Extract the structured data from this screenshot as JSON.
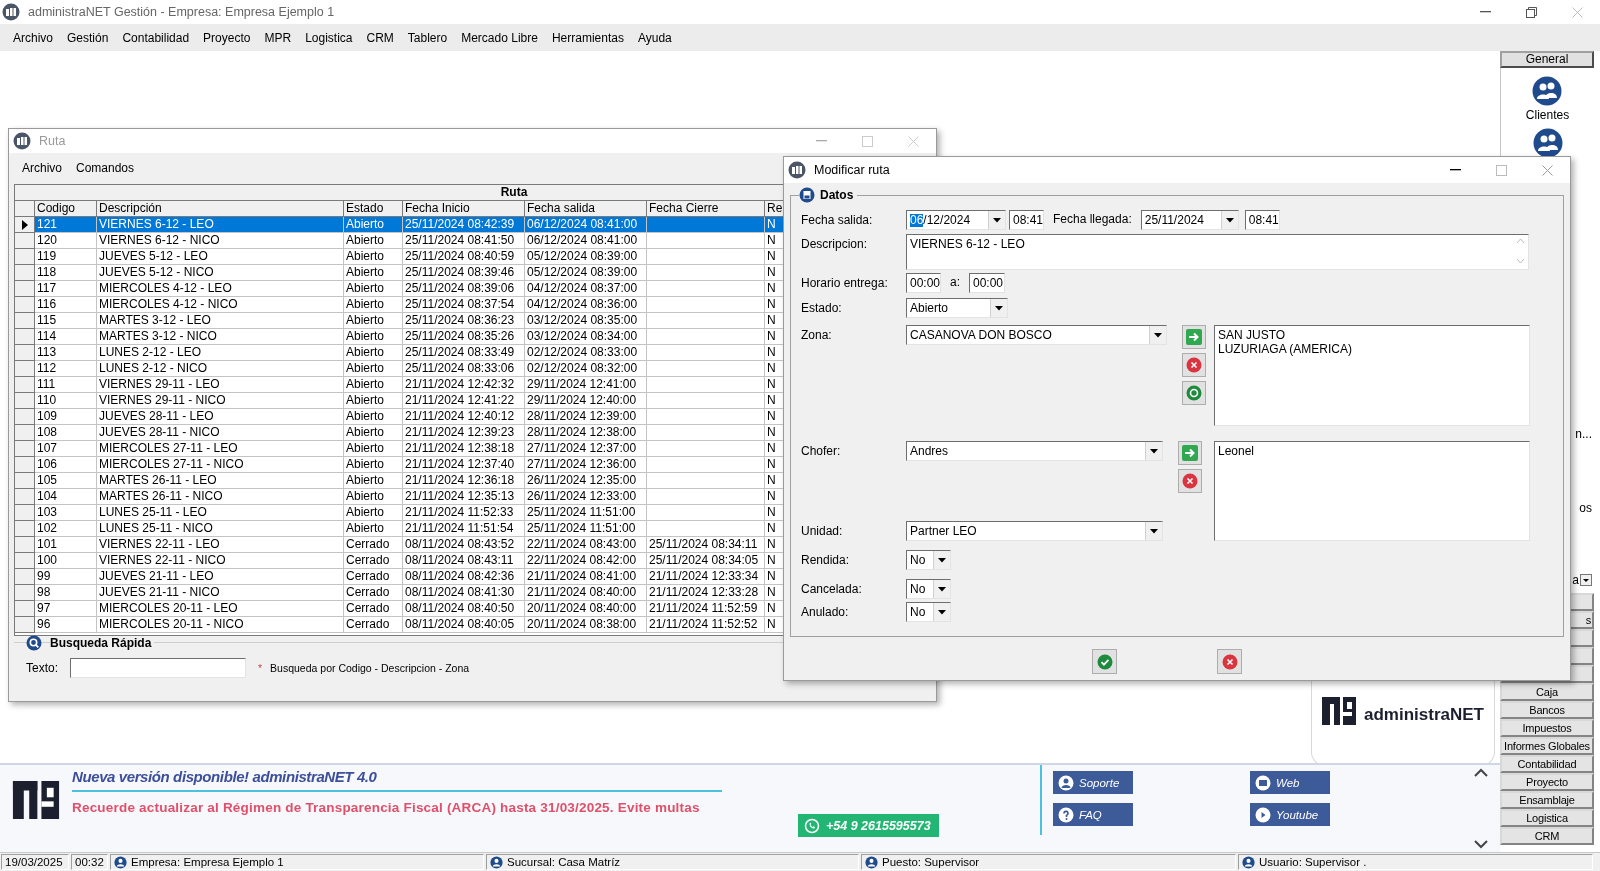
{
  "app": {
    "title": "administraNET Gestión - Empresa: Empresa Ejemplo 1",
    "menu": [
      {
        "label": "Archivo"
      },
      {
        "label": "Gestión"
      },
      {
        "label": "Contabilidad"
      },
      {
        "label": "Proyecto"
      },
      {
        "label": "MPR"
      },
      {
        "label": "Logistica"
      },
      {
        "label": "CRM"
      },
      {
        "label": "Tablero"
      },
      {
        "label": "Mercado Libre"
      },
      {
        "label": "Herramientas"
      },
      {
        "label": "Ayuda"
      }
    ]
  },
  "ruta_window": {
    "title": "Ruta",
    "menu": [
      {
        "label": "Archivo"
      },
      {
        "label": "Comandos"
      }
    ],
    "grid": {
      "title": "Ruta",
      "columns": [
        "Codigo",
        "Descripción",
        "Estado",
        "Fecha Inicio",
        "Fecha salida",
        "Fecha Cierre",
        "Re"
      ],
      "rows": [
        {
          "selected": true,
          "cells": [
            "121",
            "VIERNES 6-12 - LEO",
            "Abierto",
            "25/11/2024 08:42:39",
            "06/12/2024 08:41:00",
            "",
            "N"
          ]
        },
        {
          "selected": false,
          "cells": [
            "120",
            "VIERNES 6-12 - NICO",
            "Abierto",
            "25/11/2024 08:41:50",
            "06/12/2024 08:41:00",
            "",
            "N"
          ]
        },
        {
          "selected": false,
          "cells": [
            "119",
            "JUEVES 5-12 - LEO",
            "Abierto",
            "25/11/2024 08:40:59",
            "05/12/2024 08:39:00",
            "",
            "N"
          ]
        },
        {
          "selected": false,
          "cells": [
            "118",
            "JUEVES 5-12 - NICO",
            "Abierto",
            "25/11/2024 08:39:46",
            "05/12/2024 08:39:00",
            "",
            "N"
          ]
        },
        {
          "selected": false,
          "cells": [
            "117",
            "MIERCOLES 4-12 - LEO",
            "Abierto",
            "25/11/2024 08:39:06",
            "04/12/2024 08:37:00",
            "",
            "N"
          ]
        },
        {
          "selected": false,
          "cells": [
            "116",
            "MIERCOLES 4-12 - NICO",
            "Abierto",
            "25/11/2024 08:37:54",
            "04/12/2024 08:36:00",
            "",
            "N"
          ]
        },
        {
          "selected": false,
          "cells": [
            "115",
            "MARTES 3-12 - LEO",
            "Abierto",
            "25/11/2024 08:36:23",
            "03/12/2024 08:35:00",
            "",
            "N"
          ]
        },
        {
          "selected": false,
          "cells": [
            "114",
            "MARTES 3-12 - NICO",
            "Abierto",
            "25/11/2024 08:35:26",
            "03/12/2024 08:34:00",
            "",
            "N"
          ]
        },
        {
          "selected": false,
          "cells": [
            "113",
            "LUNES 2-12 - LEO",
            "Abierto",
            "25/11/2024 08:33:49",
            "02/12/2024 08:33:00",
            "",
            "N"
          ]
        },
        {
          "selected": false,
          "cells": [
            "112",
            "LUNES 2-12 - NICO",
            "Abierto",
            "25/11/2024 08:33:06",
            "02/12/2024 08:32:00",
            "",
            "N"
          ]
        },
        {
          "selected": false,
          "cells": [
            "111",
            "VIERNES 29-11 - LEO",
            "Abierto",
            "21/11/2024 12:42:32",
            "29/11/2024 12:41:00",
            "",
            "N"
          ]
        },
        {
          "selected": false,
          "cells": [
            "110",
            "VIERNES 29-11 - NICO",
            "Abierto",
            "21/11/2024 12:41:22",
            "29/11/2024 12:40:00",
            "",
            "N"
          ]
        },
        {
          "selected": false,
          "cells": [
            "109",
            "JUEVES 28-11 - LEO",
            "Abierto",
            "21/11/2024 12:40:12",
            "28/11/2024 12:39:00",
            "",
            "N"
          ]
        },
        {
          "selected": false,
          "cells": [
            "108",
            "JUEVES 28-11 - NICO",
            "Abierto",
            "21/11/2024 12:39:23",
            "28/11/2024 12:38:00",
            "",
            "N"
          ]
        },
        {
          "selected": false,
          "cells": [
            "107",
            "MIERCOLES 27-11 - LEO",
            "Abierto",
            "21/11/2024 12:38:18",
            "27/11/2024 12:37:00",
            "",
            "N"
          ]
        },
        {
          "selected": false,
          "cells": [
            "106",
            "MIERCOLES 27-11 - NICO",
            "Abierto",
            "21/11/2024 12:37:40",
            "27/11/2024 12:36:00",
            "",
            "N"
          ]
        },
        {
          "selected": false,
          "cells": [
            "105",
            "MARTES 26-11 - LEO",
            "Abierto",
            "21/11/2024 12:36:18",
            "26/11/2024 12:35:00",
            "",
            "N"
          ]
        },
        {
          "selected": false,
          "cells": [
            "104",
            "MARTES 26-11 - NICO",
            "Abierto",
            "21/11/2024 12:35:13",
            "26/11/2024 12:33:00",
            "",
            "N"
          ]
        },
        {
          "selected": false,
          "cells": [
            "103",
            "LUNES 25-11 - LEO",
            "Abierto",
            "21/11/2024 11:52:33",
            "25/11/2024 11:51:00",
            "",
            "N"
          ]
        },
        {
          "selected": false,
          "cells": [
            "102",
            "LUNES 25-11 - NICO",
            "Abierto",
            "21/11/2024 11:51:54",
            "25/11/2024 11:51:00",
            "",
            "N"
          ]
        },
        {
          "selected": false,
          "cells": [
            "101",
            "VIERNES 22-11 - LEO",
            "Cerrado",
            "08/11/2024 08:43:52",
            "22/11/2024 08:43:00",
            "25/11/2024 08:34:11",
            "N"
          ]
        },
        {
          "selected": false,
          "cells": [
            "100",
            "VIERNES 22-11 - NICO",
            "Cerrado",
            "08/11/2024 08:43:11",
            "22/11/2024 08:42:00",
            "25/11/2024 08:34:05",
            "N"
          ]
        },
        {
          "selected": false,
          "cells": [
            "99",
            "JUEVES 21-11 - LEO",
            "Cerrado",
            "08/11/2024 08:42:36",
            "21/11/2024 08:41:00",
            "21/11/2024 12:33:34",
            "N"
          ]
        },
        {
          "selected": false,
          "cells": [
            "98",
            "JUEVES 21-11 - NICO",
            "Cerrado",
            "08/11/2024 08:41:30",
            "21/11/2024 08:40:00",
            "21/11/2024 12:33:28",
            "N"
          ]
        },
        {
          "selected": false,
          "cells": [
            "97",
            "MIERCOLES 20-11 - LEO",
            "Cerrado",
            "08/11/2024 08:40:50",
            "20/11/2024 08:40:00",
            "21/11/2024 11:52:59",
            "N"
          ]
        },
        {
          "selected": false,
          "cells": [
            "96",
            "MIERCOLES 20-11 - NICO",
            "Cerrado",
            "08/11/2024 08:40:05",
            "20/11/2024 08:38:00",
            "21/11/2024 11:52:52",
            "N"
          ]
        }
      ]
    },
    "quick_search": {
      "title": "Busqueda Rápida",
      "label": "Texto:",
      "mark": "*",
      "hint": "Busqueda por Codigo - Descripcion - Zona"
    }
  },
  "dialog": {
    "title": "Modificar ruta",
    "group": "Datos",
    "fecha_salida": {
      "label": "Fecha salida:",
      "selected": "06",
      "value": "/12/2024",
      "time": "08:41"
    },
    "fecha_llegada": {
      "label": "Fecha llegada:",
      "value": "25/11/2024",
      "time": "08:41"
    },
    "descripcion": {
      "label": "Descripcion:",
      "value": "VIERNES 6-12 - LEO"
    },
    "horario": {
      "label": "Horario entrega:",
      "from": "00:00",
      "separator": "a:",
      "to": "00:00"
    },
    "estado": {
      "label": "Estado:",
      "value": "Abierto"
    },
    "zona": {
      "label": "Zona:",
      "value": "CASANOVA  DON BOSCO",
      "list": [
        "SAN JUSTO",
        "LUZURIAGA (AMERICA)"
      ]
    },
    "chofer": {
      "label": "Chofer:",
      "value": "Andres",
      "list": [
        "Leonel"
      ]
    },
    "unidad": {
      "label": "Unidad:",
      "value": "Partner LEO"
    },
    "flags": [
      {
        "label": "Rendida:",
        "value": "No"
      },
      {
        "label": "Cancelada:",
        "value": "No"
      },
      {
        "label": "Anulado:",
        "value": "No"
      }
    ]
  },
  "sidebar": {
    "header": "General",
    "shortcuts": [
      {
        "kind": "labeled",
        "label": "Clientes"
      },
      {
        "kind": "icon"
      }
    ],
    "fragments": [
      {
        "kind": "text",
        "text": "n..."
      },
      {
        "kind": "text",
        "text": "os"
      },
      {
        "kind": "dropdown",
        "text": "a"
      }
    ],
    "buttons": [
      {
        "kind": "covered"
      },
      {
        "kind": "covered",
        "label": "s"
      },
      {
        "kind": "covered"
      },
      {
        "kind": "covered"
      },
      {
        "kind": "covered"
      },
      {
        "kind": "full",
        "label": "Caja"
      },
      {
        "kind": "full",
        "label": "Bancos"
      },
      {
        "kind": "full",
        "label": "Impuestos"
      },
      {
        "kind": "full",
        "label": "Informes Globales"
      },
      {
        "kind": "full",
        "label": "Contabilidad"
      },
      {
        "kind": "full",
        "label": "Proyecto"
      },
      {
        "kind": "full",
        "label": "Ensamblaje"
      },
      {
        "kind": "full",
        "label": "Logistica"
      },
      {
        "kind": "full",
        "label": "CRM"
      }
    ]
  },
  "logo": {
    "text": "administraNET"
  },
  "banner": {
    "headline": "Nueva versión disponible! administraNET 4.0",
    "notice": "Recuerde actualizar al Régimen de Transparencia Fiscal (ARCA) hasta 31/03/2025. Evite multas",
    "whatsapp": "+54 9 2615595573",
    "links": [
      {
        "kind": "support",
        "label": "Soporte"
      },
      {
        "kind": "web",
        "label": "Web"
      },
      {
        "kind": "faq",
        "label": "FAQ"
      },
      {
        "kind": "youtube",
        "label": "Youtube"
      }
    ]
  },
  "status_bar": [
    {
      "kind": "text",
      "text": "19/03/2025"
    },
    {
      "kind": "text",
      "text": "00:32"
    },
    {
      "kind": "icon",
      "text": "Empresa: Empresa Ejemplo 1"
    },
    {
      "kind": "icon",
      "text": "Sucursal: Casa Matríz"
    },
    {
      "kind": "icon",
      "text": "Puesto: Supervisor"
    },
    {
      "kind": "icon",
      "text": "Usuario: Supervisor ."
    }
  ]
}
